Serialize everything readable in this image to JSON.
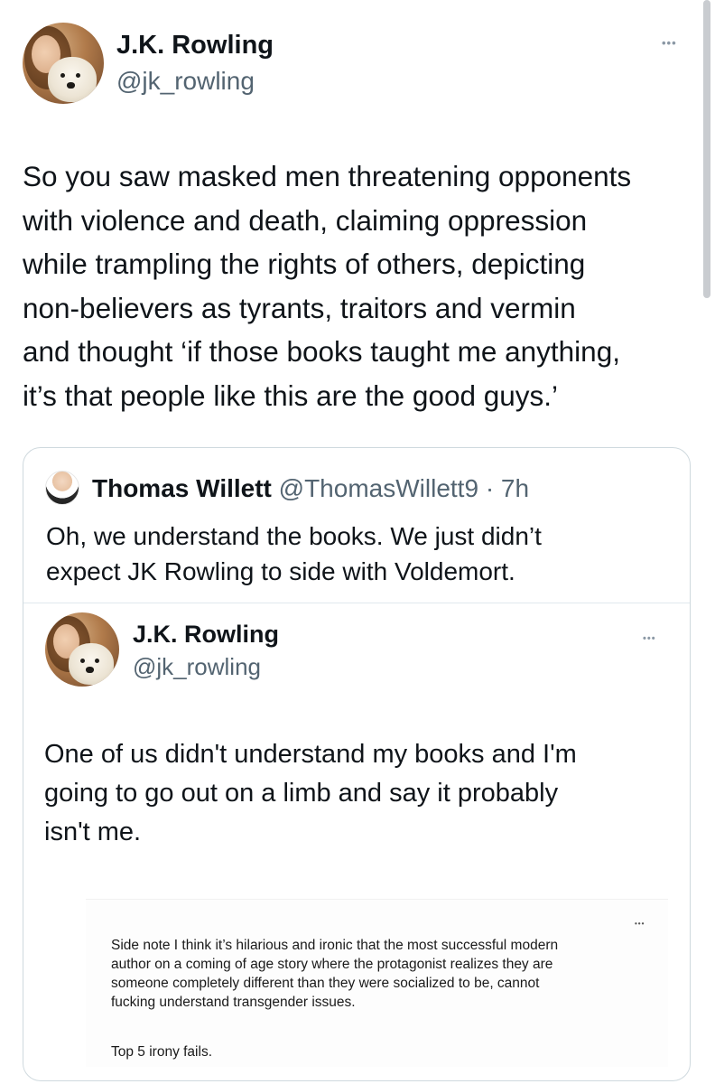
{
  "main_tweet": {
    "author_name": "J.K. Rowling",
    "author_handle": "@jk_rowling",
    "more_glyph": "•••",
    "text": "So you saw masked men threatening opponents\nwith violence and death, claiming oppression\nwhile trampling the rights of others, depicting\nnon-believers as tyrants, traitors and vermin\nand thought ‘if those books taught me anything,\nit’s that people like this are the good guys.’"
  },
  "quoted_tweet": {
    "author_name": "Thomas Willett",
    "author_handle": "@ThomasWillett9",
    "separator": "·",
    "time": "7h",
    "text": "Oh, we understand the books. We just didn’t\nexpect JK Rowling to side with Voldemort."
  },
  "nested_tweet": {
    "author_name": "J.K. Rowling",
    "author_handle": "@jk_rowling",
    "more_glyph": "•••",
    "text": "One of us didn't understand my books and I'm\ngoing to go out on a limb and say it probably\nisn't me."
  },
  "embedded_screenshot": {
    "more_glyph": "•••",
    "text": "Side note I think it’s hilarious and ironic that the most successful modern\nauthor on a coming of age story where the protagonist realizes they are\nsomeone completely different than they were socialized to be, cannot\nfucking understand transgender issues.",
    "footer": "Top 5 irony fails."
  },
  "colors": {
    "text_primary": "#0f1419",
    "text_secondary": "#536471",
    "border": "#cfd9de"
  },
  "icons": [
    "avatar-jk-rowling",
    "avatar-thomas-willett",
    "more-icon"
  ]
}
